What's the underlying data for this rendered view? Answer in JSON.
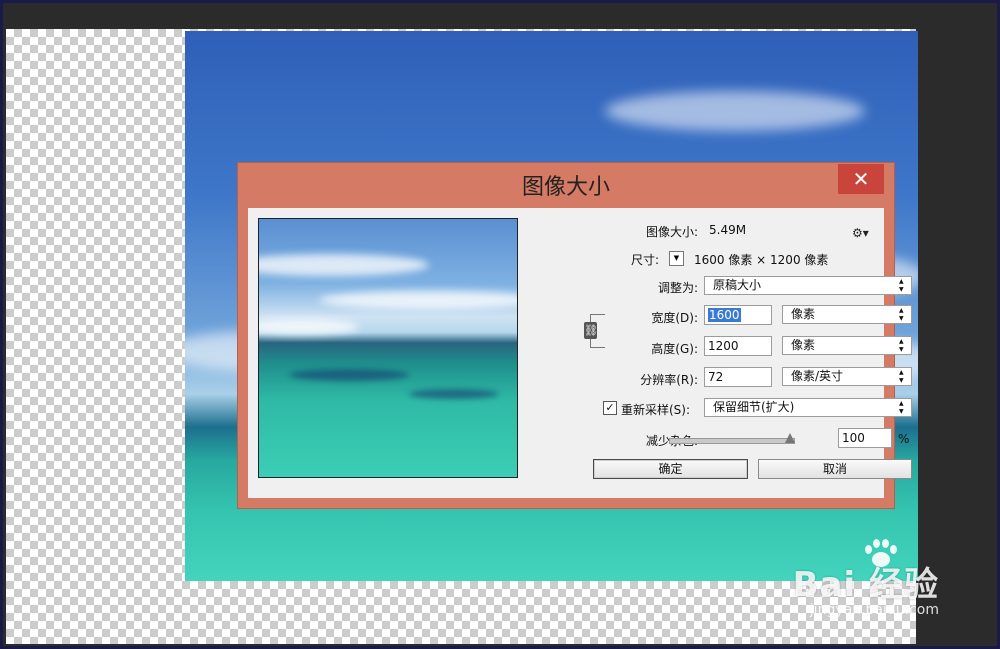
{
  "dialog": {
    "title": "图像大小",
    "close_glyph": "✕",
    "image_size_label": "图像大小:",
    "image_size_value": "5.49M",
    "settings_icon": "gear-icon",
    "dimensions_label": "尺寸:",
    "dimensions_value": "1600 像素  ×  1200 像素",
    "fit_to_label": "调整为:",
    "fit_to_value": "原稿大小",
    "width_label": "宽度(D):",
    "width_value": "1600",
    "width_unit": "像素",
    "height_label": "高度(G):",
    "height_value": "1200",
    "height_unit": "像素",
    "resolution_label": "分辨率(R):",
    "resolution_value": "72",
    "resolution_unit": "像素/英寸",
    "resample_label": "重新采样(S):",
    "resample_checked": true,
    "resample_value": "保留细节(扩大)",
    "reduce_noise_label": "减少杂色:",
    "reduce_noise_value": "100",
    "reduce_noise_unit": "%",
    "ok_label": "确定",
    "cancel_label": "取消"
  },
  "watermark": {
    "main": "Bai 经验",
    "sub": "jingyan.baidu.com"
  },
  "colors": {
    "dialog_frame": "#d57a64",
    "close_button": "#c9453c",
    "selection": "#3a7ad4"
  }
}
